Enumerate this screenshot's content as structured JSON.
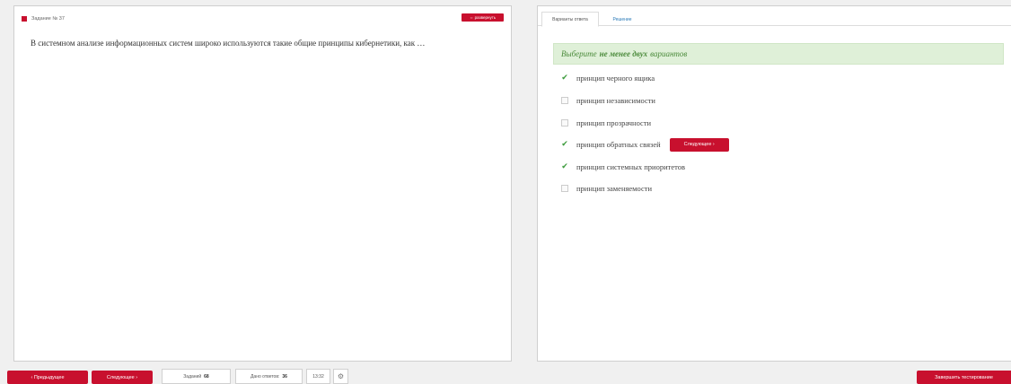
{
  "question": {
    "number_label": "Задание № 37",
    "expand_label": "⇔ развернуть",
    "text": "В системном анализе информационных систем широко используются такие общие принципы кибернетики, как …"
  },
  "tabs": [
    {
      "label": "Варианты ответа",
      "active": true
    },
    {
      "label": "Решение",
      "active": false
    }
  ],
  "hint": {
    "prefix": "Выберите",
    "emphasis": "не менее двух",
    "suffix": "вариантов"
  },
  "options": [
    {
      "label": "принцип черного ящика",
      "checked": true
    },
    {
      "label": "принцип независимости",
      "checked": false
    },
    {
      "label": "принцип прозрачности",
      "checked": false
    },
    {
      "label": "принцип обратных связей",
      "checked": true
    },
    {
      "label": "принцип системных приоритетов",
      "checked": true
    },
    {
      "label": "принцип заменяемости",
      "checked": false
    }
  ],
  "inline_next_label": "Следующее ›",
  "footer": {
    "prev_label": "‹ Предыдущее",
    "next_label": "Следующее ›",
    "tasks_label": "Заданий",
    "tasks_value": "68",
    "answered_label": "Дано ответов",
    "answered_value": "36",
    "timer": "13:32",
    "finish_label": "Завершить тестирование"
  },
  "colors": {
    "accent_red": "#c8102e",
    "hint_bg": "#dff0d8",
    "check_green": "#3c9b3c",
    "link_blue": "#2a7ab8"
  }
}
